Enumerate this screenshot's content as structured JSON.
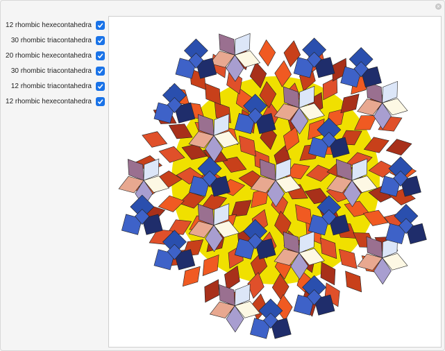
{
  "controls": [
    {
      "label": "12 rhombic hexecontahedra",
      "checked": true
    },
    {
      "label": "30 rhombic triacontahedra",
      "checked": true
    },
    {
      "label": "20 rhombic hexecontahedra",
      "checked": true
    },
    {
      "label": "30 rhombic triacontahedra",
      "checked": true
    },
    {
      "label": "12 rhombic triacontahedra",
      "checked": true
    },
    {
      "label": "12 rhombic hexecontahedra",
      "checked": true
    }
  ],
  "colors": {
    "blue": [
      "#2a4fae",
      "#1f2d6b",
      "#3e62c8",
      "#2b3f8a"
    ],
    "orange": [
      "#f05a22",
      "#c8401a",
      "#e0502a",
      "#a8301a"
    ],
    "pastel": [
      "#fdf8e4",
      "#a89ed0",
      "#e8a890",
      "#9a7090",
      "#dce6f8"
    ],
    "yellow": "#f0e000",
    "accent": "#1a73e8"
  }
}
